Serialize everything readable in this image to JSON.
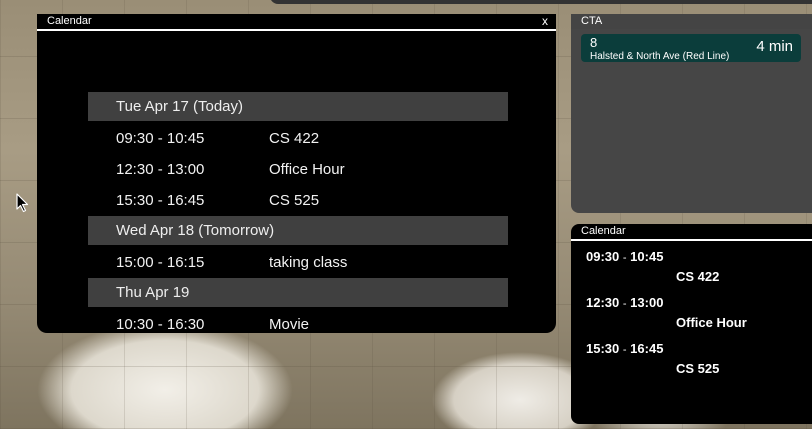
{
  "main_calendar": {
    "title": "Calendar",
    "close_label": "x",
    "days": [
      {
        "header": "Tue Apr 17  (Today)",
        "events": [
          {
            "time": "09:30 - 10:45",
            "title": "CS 422"
          },
          {
            "time": "12:30 - 13:00",
            "title": "Office Hour"
          },
          {
            "time": "15:30 - 16:45",
            "title": "CS 525"
          }
        ]
      },
      {
        "header": "Wed Apr 18  (Tomorrow)",
        "events": [
          {
            "time": "15:00 - 16:15",
            "title": "taking class"
          }
        ]
      },
      {
        "header": "Thu Apr 19",
        "events": [
          {
            "time": "10:30 - 16:30",
            "title": "Movie"
          }
        ]
      }
    ]
  },
  "cta": {
    "title": "CTA",
    "arrivals": [
      {
        "route": "8",
        "stop": "Halsted & North Ave (Red Line)",
        "eta": "4 min"
      }
    ]
  },
  "mini_calendar": {
    "title": "Calendar",
    "events": [
      {
        "start": "09:30",
        "sep": "-",
        "end": "10:45",
        "title": "CS 422"
      },
      {
        "start": "12:30",
        "sep": "-",
        "end": "13:00",
        "title": "Office Hour"
      },
      {
        "start": "15:30",
        "sep": "-",
        "end": "16:45",
        "title": "CS 525"
      }
    ]
  },
  "colors": {
    "panel_bg": "#000000",
    "day_header_bg": "#404040",
    "cta_bg": "#464646",
    "cta_item_bg": "#0b3d3b"
  }
}
